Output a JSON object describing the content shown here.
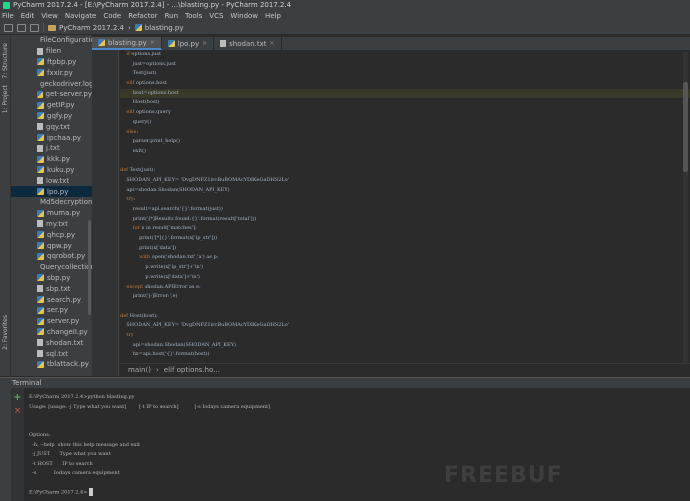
{
  "window": {
    "title": "PyCharm 2017.2.4 - [E:\\PyCharm 2017.2.4] - ...\\blasting.py - PyCharm 2017.2.4"
  },
  "menu": [
    "File",
    "Edit",
    "View",
    "Navigate",
    "Code",
    "Refactor",
    "Run",
    "Tools",
    "VCS",
    "Window",
    "Help"
  ],
  "nav": {
    "project": "PyCharm 2017.2.4",
    "file": "blasting.py"
  },
  "side_stripe": {
    "structure": "7: Structure",
    "project": "1: Project",
    "favorites": "2: Favorites"
  },
  "project_tree": [
    {
      "name": "FileConfiguration",
      "type": "log"
    },
    {
      "name": "filen",
      "type": "txt"
    },
    {
      "name": "ftpbp.py",
      "type": "py"
    },
    {
      "name": "fxxir.py",
      "type": "py"
    },
    {
      "name": "geckodriver.log",
      "type": "log"
    },
    {
      "name": "get-server.py",
      "type": "py"
    },
    {
      "name": "getIP.py",
      "type": "py"
    },
    {
      "name": "gqfy.py",
      "type": "py"
    },
    {
      "name": "gqy.txt",
      "type": "txt"
    },
    {
      "name": "ipchaa.py",
      "type": "py"
    },
    {
      "name": "j.txt",
      "type": "txt"
    },
    {
      "name": "kkk.py",
      "type": "py"
    },
    {
      "name": "kuku.py",
      "type": "py"
    },
    {
      "name": "low.txt",
      "type": "txt"
    },
    {
      "name": "lpo.py",
      "type": "py",
      "selected": true
    },
    {
      "name": "Md5decryption.py",
      "type": "py"
    },
    {
      "name": "muma.py",
      "type": "py"
    },
    {
      "name": "my.txt",
      "type": "txt"
    },
    {
      "name": "qhcp.py",
      "type": "py"
    },
    {
      "name": "qpw.py",
      "type": "py"
    },
    {
      "name": "qqrobot.py",
      "type": "py"
    },
    {
      "name": "Querycollection.py",
      "type": "py"
    },
    {
      "name": "sbp.py",
      "type": "py"
    },
    {
      "name": "sbp.txt",
      "type": "txt"
    },
    {
      "name": "search.py",
      "type": "py"
    },
    {
      "name": "ser.py",
      "type": "py"
    },
    {
      "name": "server.py",
      "type": "py"
    },
    {
      "name": "changeII.py",
      "type": "py"
    },
    {
      "name": "shodan.txt",
      "type": "txt"
    },
    {
      "name": "sql.txt",
      "type": "txt"
    },
    {
      "name": "tblattack.py",
      "type": "py"
    }
  ],
  "tabs": [
    {
      "label": "blasting.py",
      "type": "py",
      "active": true
    },
    {
      "label": "lpo.py",
      "type": "py"
    },
    {
      "label": "shodan.txt",
      "type": "txt"
    }
  ],
  "code": [
    {
      "text": "    if options.just",
      "kw": "if"
    },
    {
      "text": "        just=options.just"
    },
    {
      "text": "        Test(just)"
    },
    {
      "text": "    elif options.host",
      "kw": "elif"
    },
    {
      "text": "        host=options.host",
      "hl": true
    },
    {
      "text": "        Host(host)"
    },
    {
      "text": "    elif options.query",
      "kw": "elif"
    },
    {
      "text": "        query()"
    },
    {
      "text": "    else:",
      "kw": "else"
    },
    {
      "text": "        parser.print_help()"
    },
    {
      "text": "        exit()"
    },
    {
      "text": ""
    },
    {
      "text": "def Test(just):",
      "kw": "def"
    },
    {
      "text": "    SHODAN_API_KEY= 'DvgDNFZ1ircBuBOMAcYDIKeGaDHS2Lo'"
    },
    {
      "text": "    api=shodan.Shodan(SHODAN_API_KEY)"
    },
    {
      "text": "    try:",
      "kw": "try"
    },
    {
      "text": "        result=api.search('{}'.format(just))"
    },
    {
      "text": "        print('[*]Results found:{}'.format(result['total']))"
    },
    {
      "text": "        for x in result['matches']:",
      "kw": "for"
    },
    {
      "text": "            print('[*]{}'.format(x['ip_str']))"
    },
    {
      "text": "            print(x['data'])"
    },
    {
      "text": "            with open('shodan.txt','a') as p:",
      "kw": "with"
    },
    {
      "text": "                p.write(x['ip_str']+'\\n')"
    },
    {
      "text": "                p.write(x['data']+'\\n')"
    },
    {
      "text": "    except shodan.APIError as e:",
      "kw": "except"
    },
    {
      "text": "        print('[-]Error:',e)"
    },
    {
      "text": ""
    },
    {
      "text": "def Host(host):",
      "kw": "def"
    },
    {
      "text": "    SHODAN_API_KEY= 'DvgDNFZ1ircBuBOMAcYDIKeGaDHS2Lo'"
    },
    {
      "text": "    try",
      "kw": "try"
    },
    {
      "text": "        api=shodan.Shodan(SHODAN_API_KEY)"
    },
    {
      "text": "        hx=api.host('{}'.format(host))"
    }
  ],
  "editor_breadcrumb": {
    "func": "main()",
    "branch": "elif options.ho..."
  },
  "terminal": {
    "header": "Terminal",
    "lines": [
      "E:\\PyCharm 2017.2.4>python blasting.py",
      "Usage: [usage: -j Type what you want]        [-t IP to search]          [-s Iodays camera equipment]",
      "",
      "",
      "Options:",
      "  -h, --help  show this help message and exit",
      "  -j JUST      Type what you want",
      "  -t HOST      IP to search",
      "  -s           Iodays camera equipment",
      ""
    ],
    "prompt": "E:\\PyCharm 2017.2.4>"
  },
  "watermark": "FREEBUF"
}
